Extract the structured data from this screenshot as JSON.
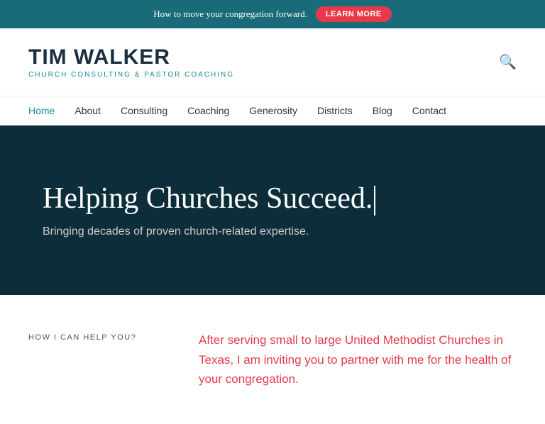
{
  "banner": {
    "message": "How to move your congregation forward.",
    "button_label": "LEARN MORE"
  },
  "header": {
    "logo_title": "TIM WALKER",
    "logo_subtitle": "Church Consulting & Pastor Coaching",
    "search_icon": "🔍"
  },
  "nav": {
    "items": [
      {
        "label": "Home",
        "active": true
      },
      {
        "label": "About",
        "active": false
      },
      {
        "label": "Consulting",
        "active": false
      },
      {
        "label": "Coaching",
        "active": false
      },
      {
        "label": "Generosity",
        "active": false
      },
      {
        "label": "Districts",
        "active": false
      },
      {
        "label": "Blog",
        "active": false
      },
      {
        "label": "Contact",
        "active": false
      }
    ]
  },
  "hero": {
    "title": "Helping Churches Succeed.",
    "subtitle": "Bringing decades of proven church-related expertise."
  },
  "content": {
    "label": "HOW I CAN HELP YOU?",
    "text": "After serving small to large United Methodist Churches in Texas, I am inviting you to partner with me for the health of your congregation."
  }
}
